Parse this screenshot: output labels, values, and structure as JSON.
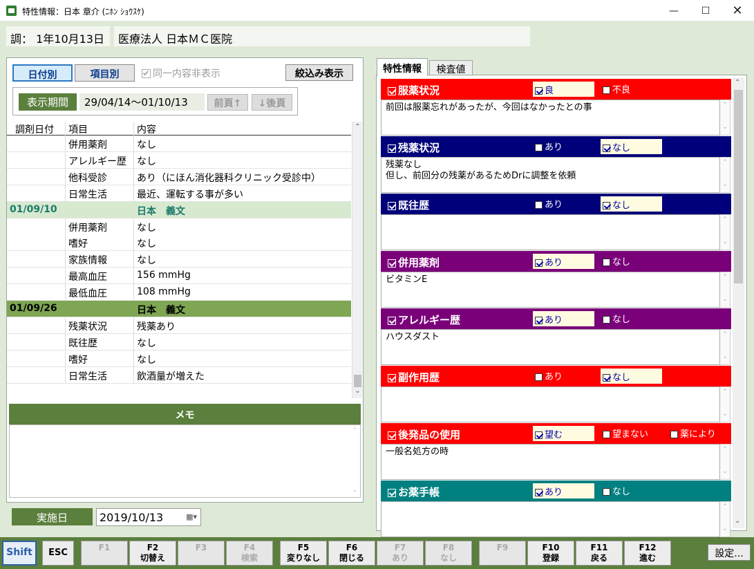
{
  "window": {
    "title": "特性情報：日本 章介 (ﾆﾎﾝ ｼｮｳｽｹ)"
  },
  "header": {
    "prep_label": "調： 1年10月13日",
    "clinic": "医療法人 日本ＭＣ医院"
  },
  "left": {
    "tab_by_date": "日付別",
    "tab_by_item": "項目別",
    "hide_same_label": "同一内容非表示",
    "filter_button": "絞込み表示",
    "period_label": "表示期間",
    "period_value": "29/04/14～01/10/13",
    "prev_page": "前頁↑",
    "next_page": "↓後頁",
    "columns": [
      "調剤日付",
      "項目",
      "内容"
    ],
    "rows": [
      {
        "date": "",
        "item": "併用薬剤",
        "content": "なし",
        "type": "item"
      },
      {
        "date": "",
        "item": "アレルギー歴",
        "content": "なし",
        "type": "item"
      },
      {
        "date": "",
        "item": "他科受診",
        "content": "あり（にほん消化器科クリニック受診中）",
        "type": "item"
      },
      {
        "date": "",
        "item": "日常生活",
        "content": "最近、運転する事が多い",
        "type": "item"
      },
      {
        "date": "01/09/10",
        "item": "",
        "content": "日本　義文",
        "type": "group-light"
      },
      {
        "date": "",
        "item": "併用薬剤",
        "content": "なし",
        "type": "item"
      },
      {
        "date": "",
        "item": "嗜好",
        "content": "なし",
        "type": "item"
      },
      {
        "date": "",
        "item": "家族情報",
        "content": "なし",
        "type": "item"
      },
      {
        "date": "",
        "item": "最高血圧",
        "content": "156 mmHg",
        "type": "item"
      },
      {
        "date": "",
        "item": "最低血圧",
        "content": "108 mmHg",
        "type": "item"
      },
      {
        "date": "01/09/26",
        "item": "",
        "content": "日本　義文",
        "type": "group-dark"
      },
      {
        "date": "",
        "item": "残薬状況",
        "content": "残薬あり",
        "type": "item"
      },
      {
        "date": "",
        "item": "既往歴",
        "content": "なし",
        "type": "item"
      },
      {
        "date": "",
        "item": "嗜好",
        "content": "なし",
        "type": "item"
      },
      {
        "date": "",
        "item": "日常生活",
        "content": "飲酒量が増えた",
        "type": "item"
      }
    ],
    "memo_title": "メモ",
    "impl_label": "実施日",
    "impl_date": "2019/10/13"
  },
  "right": {
    "tabs": [
      "特性情報",
      "検査値"
    ],
    "sections": [
      {
        "title": "服薬状況",
        "color": "#ff0000",
        "options": [
          {
            "label": "良",
            "checked": true
          },
          {
            "label": "不良",
            "checked": false
          }
        ],
        "text": "前回は服薬忘れがあったが、今回はなかったとの事"
      },
      {
        "title": "残薬状況",
        "color": "#00007a",
        "options": [
          {
            "label": "あり",
            "checked": false
          },
          {
            "label": "なし",
            "checked": true
          }
        ],
        "text": "残薬なし\n但し、前回分の残薬があるためDrに調整を依頼"
      },
      {
        "title": "既往歴",
        "color": "#00007a",
        "options": [
          {
            "label": "あり",
            "checked": false
          },
          {
            "label": "なし",
            "checked": true
          }
        ],
        "text": ""
      },
      {
        "title": "併用薬剤",
        "color": "#7a007a",
        "options": [
          {
            "label": "あり",
            "checked": true
          },
          {
            "label": "なし",
            "checked": false
          }
        ],
        "text": "ビタミンE"
      },
      {
        "title": "アレルギー歴",
        "color": "#7a007a",
        "options": [
          {
            "label": "あり",
            "checked": true
          },
          {
            "label": "なし",
            "checked": false
          }
        ],
        "text": "ハウスダスト"
      },
      {
        "title": "副作用歴",
        "color": "#ff0000",
        "options": [
          {
            "label": "あり",
            "checked": false
          },
          {
            "label": "なし",
            "checked": true
          }
        ],
        "text": ""
      },
      {
        "title": "後発品の使用",
        "color": "#ff0000",
        "options": [
          {
            "label": "望む",
            "checked": true
          },
          {
            "label": "望まない",
            "checked": false
          },
          {
            "label": "薬により",
            "checked": false
          }
        ],
        "text": "一般名処方の時"
      },
      {
        "title": "お薬手帳",
        "color": "#008080",
        "options": [
          {
            "label": "あり",
            "checked": true
          },
          {
            "label": "なし",
            "checked": false
          }
        ],
        "text": ""
      }
    ]
  },
  "fkeys": [
    {
      "key": "Shift",
      "label": "",
      "enabled": true
    },
    {
      "key": "ESC",
      "label": "",
      "enabled": true
    },
    {
      "key": "F1",
      "label": "",
      "enabled": false
    },
    {
      "key": "F2",
      "label": "切替え",
      "enabled": true
    },
    {
      "key": "F3",
      "label": "",
      "enabled": false
    },
    {
      "key": "F4",
      "label": "検索",
      "enabled": false
    },
    {
      "key": "F5",
      "label": "変りなし",
      "enabled": true
    },
    {
      "key": "F6",
      "label": "閉じる",
      "enabled": true
    },
    {
      "key": "F7",
      "label": "あり",
      "enabled": false
    },
    {
      "key": "F8",
      "label": "なし",
      "enabled": false
    },
    {
      "key": "F9",
      "label": "",
      "enabled": false
    },
    {
      "key": "F10",
      "label": "登録",
      "enabled": true
    },
    {
      "key": "F11",
      "label": "戻る",
      "enabled": true
    },
    {
      "key": "F12",
      "label": "進む",
      "enabled": true
    }
  ],
  "settings_button": "設定..."
}
